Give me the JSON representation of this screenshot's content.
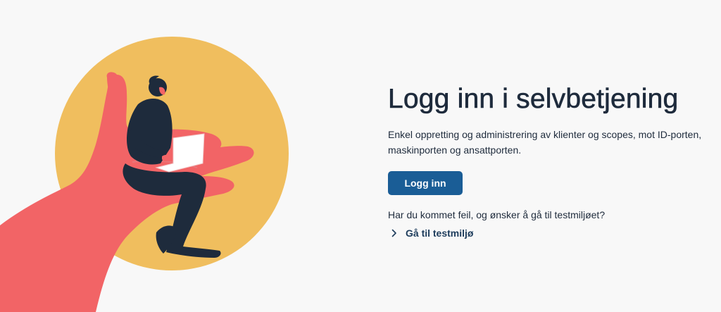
{
  "hero": {
    "title": "Logg inn i selvbetjening",
    "description": "Enkel oppretting og administrering av klienter og scopes, mot ID-porten, maskinporten og ansattporten.",
    "login_button_label": "Logg inn"
  },
  "test_environment": {
    "question": "Har du kommet feil, og ønsker å gå til testmiljøet?",
    "link_label": "Gå til testmiljø",
    "link_icon": "chevron-right-icon"
  },
  "colors": {
    "background": "#f8f8f8",
    "circle": "#f0be5e",
    "hand": "#f26466",
    "figure": "#1e2b3c",
    "button": "#1a5d96",
    "text": "#1e2b3c"
  }
}
